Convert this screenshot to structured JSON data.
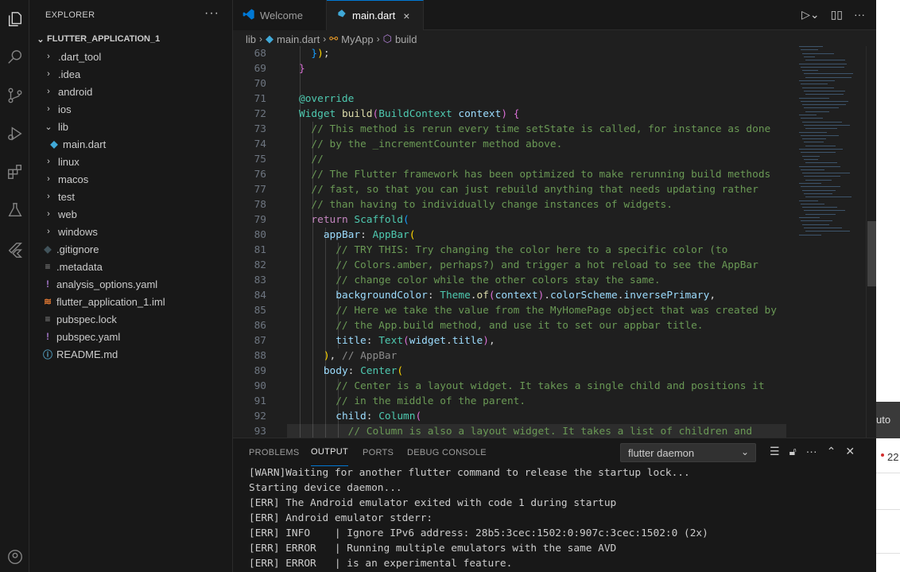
{
  "explorer": {
    "title": "EXPLORER",
    "more": "···",
    "folder_name": "FLUTTER_APPLICATION_1",
    "items": [
      {
        "label": ".dart_tool",
        "kind": "folder",
        "chev": "›"
      },
      {
        "label": ".idea",
        "kind": "folder",
        "chev": "›"
      },
      {
        "label": "android",
        "kind": "folder",
        "chev": "›"
      },
      {
        "label": "ios",
        "kind": "folder",
        "chev": "›"
      },
      {
        "label": "lib",
        "kind": "folder-open",
        "chev": "⌄"
      },
      {
        "label": "main.dart",
        "kind": "dart"
      },
      {
        "label": "linux",
        "kind": "folder",
        "chev": "›"
      },
      {
        "label": "macos",
        "kind": "folder",
        "chev": "›"
      },
      {
        "label": "test",
        "kind": "folder",
        "chev": "›"
      },
      {
        "label": "web",
        "kind": "folder",
        "chev": "›"
      },
      {
        "label": "windows",
        "kind": "folder",
        "chev": "›"
      },
      {
        "label": ".gitignore",
        "kind": "git"
      },
      {
        "label": ".metadata",
        "kind": "lines"
      },
      {
        "label": "analysis_options.yaml",
        "kind": "yaml"
      },
      {
        "label": "flutter_application_1.iml",
        "kind": "rss"
      },
      {
        "label": "pubspec.lock",
        "kind": "lines"
      },
      {
        "label": "pubspec.yaml",
        "kind": "yaml"
      },
      {
        "label": "README.md",
        "kind": "info"
      }
    ]
  },
  "tabs": [
    {
      "label": "Welcome",
      "icon": "vscode-icon",
      "active": false
    },
    {
      "label": "main.dart",
      "icon": "dart-icon",
      "active": true,
      "close": "×"
    }
  ],
  "breadcrumb": {
    "items": [
      "lib",
      "main.dart",
      "MyApp",
      "build"
    ],
    "sep": "›"
  },
  "code": {
    "line_numbers": [
      "68",
      "69",
      "70",
      "71",
      "72",
      "73",
      "74",
      "75",
      "76",
      "77",
      "78",
      "79",
      "80",
      "81",
      "82",
      "83",
      "84",
      "85",
      "86",
      "87",
      "88",
      "89",
      "90",
      "91",
      "92",
      "93"
    ]
  },
  "panel": {
    "tabs": [
      "PROBLEMS",
      "OUTPUT",
      "PORTS",
      "DEBUG CONSOLE"
    ],
    "active_tab": "OUTPUT",
    "channel": "flutter daemon",
    "output_lines": [
      "[WARN]Waiting for another flutter command to release the startup lock...",
      "Starting device daemon...",
      "[ERR] The Android emulator exited with code 1 during startup",
      "[ERR] Android emulator stderr:",
      "[ERR] INFO    | Ignore IPv6 address: 28b5:3cec:1502:0:907c:3cec:1502:0 (2x)",
      "[ERR] ERROR   | Running multiple emulators with the same AVD",
      "[ERR] ERROR   | is an experimental feature."
    ]
  },
  "background_window": {
    "text_1": "uto",
    "text_2": "22"
  },
  "colors": {
    "accent": "#0078d4",
    "editor_bg": "#1f1f1f",
    "sidebar_bg": "#181818"
  }
}
